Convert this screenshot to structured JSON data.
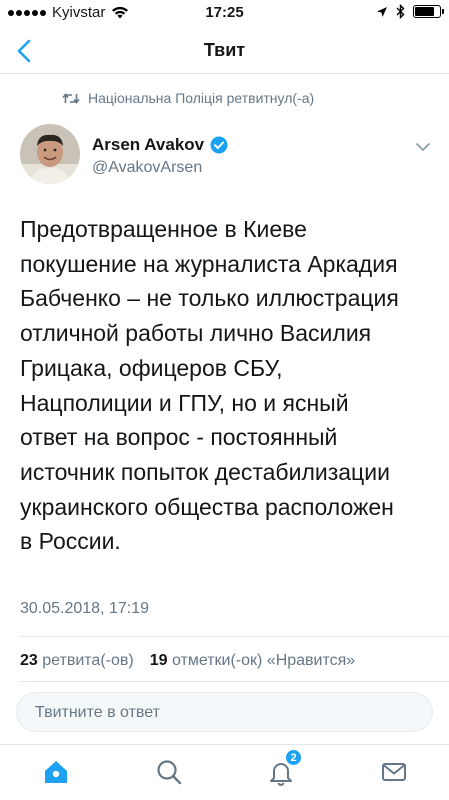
{
  "status_bar": {
    "carrier": "Kyivstar",
    "time": "17:25",
    "battery_level": 0.8
  },
  "nav": {
    "title": "Твит"
  },
  "retweet": {
    "text": "Національна Поліція ретвитнул(-а)"
  },
  "author": {
    "name": "Arsen Avakov",
    "handle": "@AvakovArsen",
    "verified": true
  },
  "tweet": {
    "text": "Предотвращенное в Киеве\nпокушение на журналиста Аркадия\nБабченко – не только иллюстрация\nотличной работы лично Василия\nГрицака, офицеров СБУ,\nНацполиции и ГПУ,  но и ясный\nответ на вопрос -  постоянный\nисточник попыток дестабилизации\nукраинского общества расположен\nв России.",
    "date": "30.05.2018, 17:19"
  },
  "stats": {
    "retweets_count": "23",
    "retweets_label": "ретвита(-ов)",
    "likes_count": "19",
    "likes_label": "отметки(-ок) «Нравится»"
  },
  "reply": {
    "placeholder": "Твитните в ответ"
  },
  "tab_bar": {
    "notifications_badge": "2"
  },
  "colors": {
    "accent": "#1da1f2",
    "text_primary": "#14171a",
    "text_secondary": "#657786"
  }
}
